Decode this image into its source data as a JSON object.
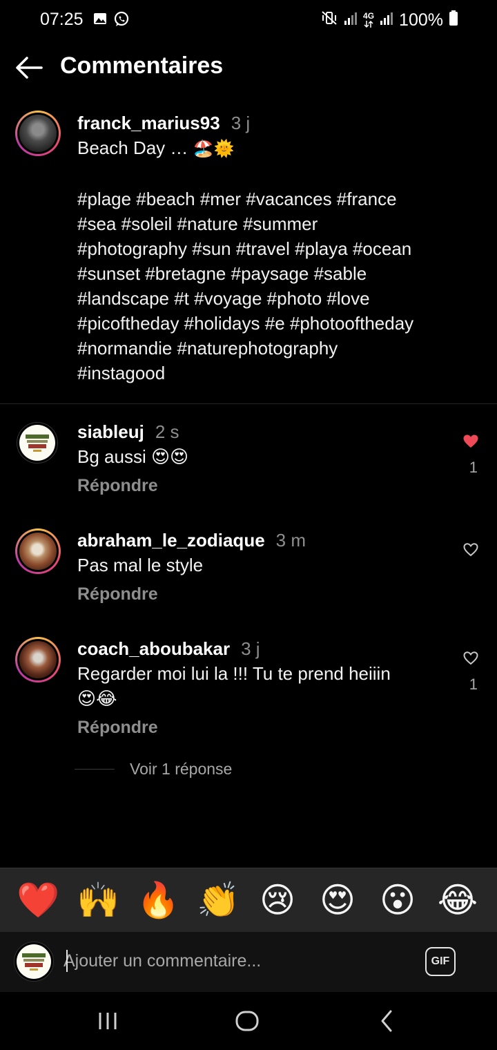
{
  "status_bar": {
    "time": "07:25",
    "network": "4G",
    "battery": "100%"
  },
  "header": {
    "title": "Commentaires"
  },
  "caption": {
    "username": "franck_marius93",
    "time": "3 j",
    "text": "Beach Day …",
    "emojis": "🏖️🌞",
    "hashtag_lines": [
      "#plage #beach #mer #vacances #france",
      "#sea #soleil #nature #summer",
      "#photography #sun #travel #playa #ocean",
      "#sunset #bretagne #paysage #sable",
      "#landscape #t #voyage #photo #love",
      "#picoftheday #holidays #e #photooftheday",
      "#normandie #naturephotography",
      "#instagood"
    ]
  },
  "comments": [
    {
      "username": "siableuj",
      "time": "2 s",
      "text": "Bg aussi 😍😍",
      "reply_label": "Répondre",
      "liked": true,
      "like_count": "1"
    },
    {
      "username": "abraham_le_zodiaque",
      "time": "3 m",
      "text": "Pas mal le style",
      "reply_label": "Répondre",
      "liked": false,
      "like_count": ""
    },
    {
      "username": "coach_aboubakar",
      "time": "3 j",
      "text": "Regarder moi lui la !!! Tu te prend heiiin",
      "text_line2": "😍😂",
      "reply_label": "Répondre",
      "liked": false,
      "like_count": "1",
      "view_replies": "Voir 1 réponse"
    }
  ],
  "emoji_bar": [
    "❤️",
    "🙌",
    "🔥",
    "👏",
    "😢",
    "😍",
    "😮",
    "😂"
  ],
  "comment_input": {
    "placeholder": "Ajouter un commentaire...",
    "gif_label": "GIF"
  },
  "colors": {
    "background": "#000000",
    "like_red": "#ed4956",
    "muted": "#8e8e8e"
  }
}
